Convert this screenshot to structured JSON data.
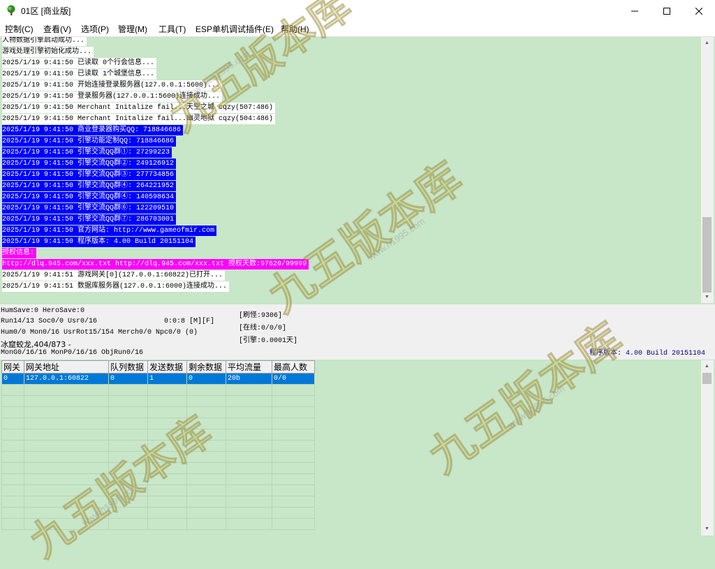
{
  "window": {
    "title": "01区 [商业版]",
    "controls": {
      "minimize": "—",
      "maximize": "☐",
      "close": "✕"
    }
  },
  "menu": [
    "控制(C)",
    "查看(V)",
    "选项(P)",
    "管理(M)",
    "工具(T)",
    "ESP单机调试插件(E)",
    "帮助(H)"
  ],
  "log": [
    {
      "text": "人物数据引擎启动成功...",
      "style": "normal"
    },
    {
      "text": "游戏处理引擎初始化成功...",
      "style": "normal"
    },
    {
      "text": "2025/1/19 9:41:50 已读取 0个行会信息...",
      "style": "normal"
    },
    {
      "text": "2025/1/19 9:41:50 已读取 1个城堡信息...",
      "style": "normal"
    },
    {
      "text": "2025/1/19 9:41:50 开始连接登录服务器(127.0.0.1:5600)...",
      "style": "normal"
    },
    {
      "text": "2025/1/19 9:41:50 登录服务器(127.0.0.1:5600)连接成功...",
      "style": "normal"
    },
    {
      "text": "2025/1/19 9:41:50 Merchant Initalize fail...天空之城 cqzy(507:486)",
      "style": "normal"
    },
    {
      "text": "2025/1/19 9:41:50 Merchant Initalize fail...幽灵地狱 cqzy(504:486)",
      "style": "normal"
    },
    {
      "text": "2025/1/19 9:41:50 商业登录器购买QQ: 718846686",
      "style": "blue"
    },
    {
      "text": "2025/1/19 9:41:50 引擎功能定制QQ: 718846686",
      "style": "blue"
    },
    {
      "text": "2025/1/19 9:41:50 引擎交流QQ群①: 27299223",
      "style": "blue"
    },
    {
      "text": "2025/1/19 9:41:50 引擎交流QQ群②: 249126912",
      "style": "blue"
    },
    {
      "text": "2025/1/19 9:41:50 引擎交流QQ群③: 277734856",
      "style": "blue"
    },
    {
      "text": "2025/1/19 9:41:50 引擎交流QQ群④: 264221952",
      "style": "blue"
    },
    {
      "text": "2025/1/19 9:41:50 引擎交流QQ群④: 140598634",
      "style": "blue"
    },
    {
      "text": "2025/1/19 9:41:50 引擎交流QQ群⑥: 122209510",
      "style": "blue"
    },
    {
      "text": "2025/1/19 9:41:50 引擎交流QQ群⑦: 286703001",
      "style": "blue"
    },
    {
      "text": "2025/1/19 9:41:50 官方网站: http://www.gameofmir.com",
      "style": "blue"
    },
    {
      "text": "2025/1/19 9:41:50 程序版本: 4.00 Build 20151104",
      "style": "blue"
    },
    {
      "text": "授权信息:",
      "style": "magenta"
    },
    {
      "text": "http://dlq.945.com/xxx.txt http://dlq.945.com/xxx.txt 授权天数:97620/99999",
      "style": "magenta"
    },
    {
      "text": "2025/1/19 9:41:51 游戏网关[0](127.0.0.1:60822)已打开...",
      "style": "normal"
    },
    {
      "text": "2025/1/19 9:41:51 数据库服务器(127.0.0.1:6000)连接成功...",
      "style": "normal"
    }
  ],
  "status": {
    "lines": [
      "HumSave:0 HeroSave:0",
      "Run14/13 Soc0/0 Usr0/16                0:0:8 [M][F]",
      "Hum0/0 Mon0/16 UsrRot15/154 Merch0/0 Npc0/0 (0)",
      "冰窟蛟龙,404/873 -",
      "MonG0/16/16 MonP0/16/16 ObjRun0/16"
    ],
    "boxes": [
      "[刷怪:9306]",
      "[在线:0/0/0]",
      "[引擎:0.0001天]"
    ],
    "version": "程序版本: 4.00 Build 20151104"
  },
  "grid": {
    "headers": [
      "网关",
      "网关地址",
      "队列数据",
      "发送数据",
      "剩余数据",
      "平均流量",
      "最高人数"
    ],
    "rows": [
      [
        "0",
        "127.0.0.1:60822",
        "0",
        "1",
        "0",
        "20b",
        "0/0"
      ]
    ]
  },
  "watermark": {
    "text": "九五版本库",
    "url": "www.h1995.com"
  },
  "colors": {
    "log_background": "#c8e6c8",
    "highlight_blue": "#0000ff",
    "highlight_magenta": "#ff00ff",
    "selected_row": "#0078d7",
    "version_text": "#000080"
  }
}
